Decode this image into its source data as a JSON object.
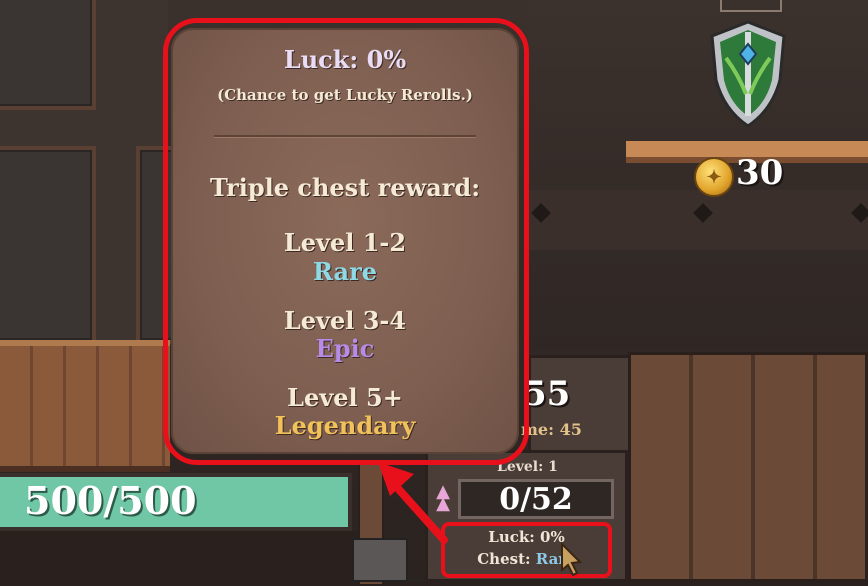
{
  "tooltip": {
    "luck_title": "Luck: 0%",
    "luck_subtitle": "(Chance to get Lucky Rerolls.)",
    "chest_header": "Triple chest reward:",
    "tiers": [
      {
        "level": "Level 1-2",
        "rarity": "Rare"
      },
      {
        "level": "Level 3-4",
        "rarity": "Epic"
      },
      {
        "level": "Level 5+",
        "rarity": "Legendary"
      }
    ]
  },
  "hud": {
    "level_tab": "Level",
    "gold": "30",
    "stat_value": "55",
    "stat_sub": "me: 45",
    "level_label": "Level: 1",
    "xp": "0/52",
    "luck_line": "Luck: 0%",
    "chest_label": "Chest:",
    "chest_value": "Rare",
    "health": "500/500"
  },
  "colors": {
    "highlight_red": "#e8101a",
    "rare": "#8ed9e6",
    "epic": "#b78be8",
    "legendary": "#f2c25a",
    "health_bar": "#6fc7a6"
  },
  "icons": [
    "shield-icon",
    "gold-coin-icon",
    "level-up-arrow-icon",
    "cursor-icon",
    "lock-icon"
  ]
}
